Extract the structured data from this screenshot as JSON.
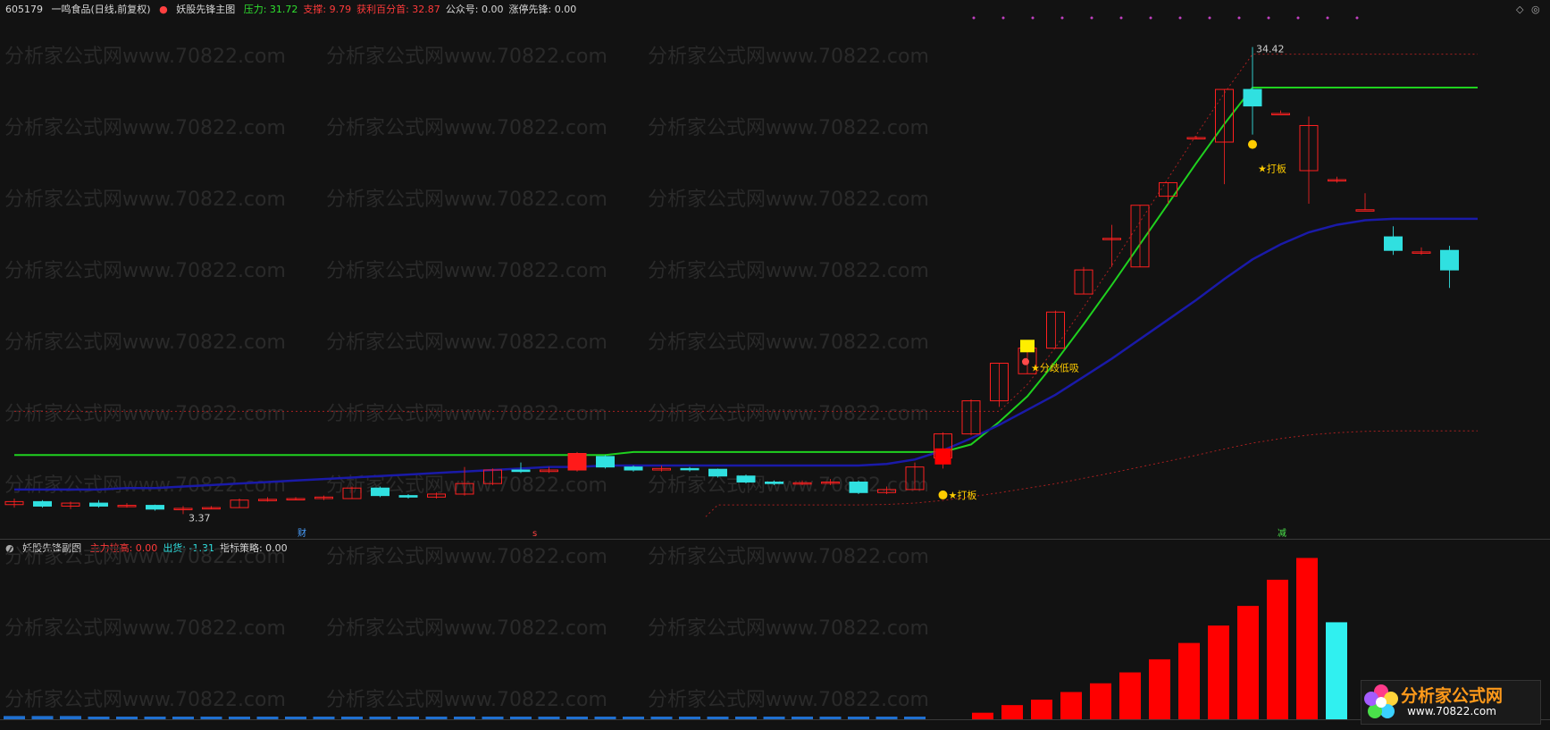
{
  "main_header": {
    "code": "605179",
    "name": "一鸣食品(日线,前复权)",
    "indicator": "妖股先锋主图",
    "items": [
      {
        "label": "压力:",
        "value": "31.72",
        "color": "#2fe12f"
      },
      {
        "label": "支撑:",
        "value": "9.79",
        "color": "#ff3a3a"
      },
      {
        "label": "获利百分首:",
        "value": "32.87",
        "color": "#ff3a3a"
      },
      {
        "label": "公众号:",
        "value": "0.00",
        "color": "#d8d8d8"
      },
      {
        "label": "涨停先锋:",
        "value": "0.00",
        "color": "#d8d8d8"
      }
    ]
  },
  "sub_header": {
    "indicator": "妖股先锋副图",
    "items": [
      {
        "label": "主力拉高:",
        "value": "0.00",
        "color": "#ff3a3a"
      },
      {
        "label": "出货:",
        "value": "-1.31",
        "color": "#30e0e0"
      },
      {
        "label": "指标策略:",
        "value": "0.00",
        "color": "#d8d8d8"
      }
    ]
  },
  "watermark": "分析家公式网www.70822.com",
  "annotations": {
    "high_price": "34.42",
    "low_price": "3.37",
    "signal_daban": "★打板",
    "signal_fenshi": "★分歧低吸",
    "marker_cai": "财",
    "marker_jian": "减",
    "marker_s": "s"
  },
  "logo": {
    "title": "分析家公式网",
    "url": "www.70822.com"
  },
  "chart_data": {
    "type": "candlestick",
    "price_range": [
      3.37,
      34.42
    ],
    "candles": [
      {
        "o": 4.0,
        "c": 4.2,
        "h": 4.4,
        "l": 3.8
      },
      {
        "o": 4.2,
        "c": 3.9,
        "h": 4.3,
        "l": 3.8
      },
      {
        "o": 3.9,
        "c": 4.1,
        "h": 4.2,
        "l": 3.7
      },
      {
        "o": 4.1,
        "c": 3.9,
        "h": 4.3,
        "l": 3.8
      },
      {
        "o": 3.9,
        "c": 3.95,
        "h": 4.1,
        "l": 3.8
      },
      {
        "o": 3.95,
        "c": 3.7,
        "h": 4.0,
        "l": 3.6
      },
      {
        "o": 3.7,
        "c": 3.75,
        "h": 3.9,
        "l": 3.37
      },
      {
        "o": 3.75,
        "c": 3.8,
        "h": 3.9,
        "l": 3.7
      },
      {
        "o": 3.8,
        "c": 4.3,
        "h": 4.4,
        "l": 3.8
      },
      {
        "o": 4.3,
        "c": 4.35,
        "h": 4.5,
        "l": 4.2
      },
      {
        "o": 4.35,
        "c": 4.4,
        "h": 4.5,
        "l": 4.3
      },
      {
        "o": 4.4,
        "c": 4.5,
        "h": 4.6,
        "l": 4.3
      },
      {
        "o": 4.4,
        "c": 5.1,
        "h": 5.2,
        "l": 4.4
      },
      {
        "o": 5.1,
        "c": 4.6,
        "h": 5.2,
        "l": 4.5
      },
      {
        "o": 4.6,
        "c": 4.5,
        "h": 4.7,
        "l": 4.4
      },
      {
        "o": 4.5,
        "c": 4.7,
        "h": 4.8,
        "l": 4.4
      },
      {
        "o": 4.7,
        "c": 5.4,
        "h": 6.5,
        "l": 4.6
      },
      {
        "o": 5.4,
        "c": 6.3,
        "h": 6.4,
        "l": 5.3
      },
      {
        "o": 6.3,
        "c": 6.2,
        "h": 6.8,
        "l": 6.1
      },
      {
        "o": 6.2,
        "c": 6.3,
        "h": 6.5,
        "l": 6.1
      },
      {
        "o": 6.3,
        "c": 7.4,
        "h": 7.5,
        "l": 6.2
      },
      {
        "o": 7.2,
        "c": 6.5,
        "h": 7.3,
        "l": 6.4
      },
      {
        "o": 6.5,
        "c": 6.3,
        "h": 6.6,
        "l": 6.2
      },
      {
        "o": 6.3,
        "c": 6.4,
        "h": 6.6,
        "l": 6.2
      },
      {
        "o": 6.4,
        "c": 6.35,
        "h": 6.5,
        "l": 6.2
      },
      {
        "o": 6.35,
        "c": 5.9,
        "h": 6.4,
        "l": 5.8
      },
      {
        "o": 5.9,
        "c": 5.5,
        "h": 6.0,
        "l": 5.4
      },
      {
        "o": 5.5,
        "c": 5.4,
        "h": 5.6,
        "l": 5.3
      },
      {
        "o": 5.4,
        "c": 5.45,
        "h": 5.6,
        "l": 5.3
      },
      {
        "o": 5.45,
        "c": 5.5,
        "h": 5.7,
        "l": 5.3
      },
      {
        "o": 5.5,
        "c": 4.8,
        "h": 5.6,
        "l": 4.7
      },
      {
        "o": 4.8,
        "c": 5.0,
        "h": 5.2,
        "l": 4.7
      },
      {
        "o": 5.0,
        "c": 6.5,
        "h": 6.8,
        "l": 5.0
      },
      {
        "o": 7.1,
        "c": 8.7,
        "h": 8.8,
        "l": 6.4
      },
      {
        "o": 8.7,
        "c": 10.9,
        "h": 11.0,
        "l": 8.6
      },
      {
        "o": 10.9,
        "c": 13.4,
        "h": 13.4,
        "l": 10.5
      },
      {
        "o": 12.7,
        "c": 14.4,
        "h": 14.4,
        "l": 12.7
      },
      {
        "o": 14.4,
        "c": 16.8,
        "h": 16.9,
        "l": 14.4
      },
      {
        "o": 18.0,
        "c": 19.6,
        "h": 19.8,
        "l": 18.0
      },
      {
        "o": 21.7,
        "c": 21.7,
        "h": 22.6,
        "l": 19.8
      },
      {
        "o": 19.8,
        "c": 23.9,
        "h": 23.9,
        "l": 19.8
      },
      {
        "o": 24.5,
        "c": 25.4,
        "h": 25.4,
        "l": 24.0
      },
      {
        "o": 28.4,
        "c": 28.4,
        "h": 28.5,
        "l": 28.3
      },
      {
        "o": 28.1,
        "c": 31.6,
        "h": 31.6,
        "l": 25.3
      },
      {
        "o": 31.6,
        "c": 30.5,
        "h": 34.42,
        "l": 28.6
      },
      {
        "o": 30.0,
        "c": 30.0,
        "h": 30.2,
        "l": 30.0
      },
      {
        "o": 26.2,
        "c": 29.2,
        "h": 29.8,
        "l": 24.0
      },
      {
        "o": 25.6,
        "c": 25.6,
        "h": 25.8,
        "l": 25.4
      },
      {
        "o": 23.6,
        "c": 23.6,
        "h": 24.7,
        "l": 23.6
      },
      {
        "o": 21.8,
        "c": 20.9,
        "h": 22.5,
        "l": 20.6
      },
      {
        "o": 20.8,
        "c": 20.8,
        "h": 21.1,
        "l": 20.6
      },
      {
        "o": 20.9,
        "c": 19.6,
        "h": 21.2,
        "l": 18.4
      }
    ],
    "resistance_line": [
      7.3,
      7.3,
      7.3,
      7.3,
      7.3,
      7.3,
      7.3,
      7.3,
      7.3,
      7.3,
      7.3,
      7.3,
      7.3,
      7.3,
      7.3,
      7.3,
      7.3,
      7.3,
      7.3,
      7.3,
      7.3,
      7.3,
      7.5,
      7.5,
      7.5,
      7.5,
      7.5,
      7.5,
      7.5,
      7.5,
      7.5,
      7.5,
      7.5,
      7.5,
      8.0,
      9.5,
      11.2,
      13.5,
      16.0,
      18.6,
      21.3,
      24.0,
      26.7,
      29.3,
      31.72,
      31.72,
      31.72,
      31.72,
      31.72,
      31.72,
      31.72,
      31.72,
      31.72
    ],
    "support_line": [
      5.0,
      5.0,
      5.0,
      5.0,
      5.1,
      5.1,
      5.2,
      5.3,
      5.4,
      5.5,
      5.6,
      5.7,
      5.8,
      5.9,
      6.0,
      6.1,
      6.2,
      6.3,
      6.4,
      6.5,
      6.5,
      6.6,
      6.6,
      6.6,
      6.6,
      6.6,
      6.6,
      6.6,
      6.6,
      6.6,
      6.6,
      6.7,
      7.0,
      7.6,
      8.4,
      9.3,
      10.3,
      11.3,
      12.5,
      13.7,
      15.0,
      16.3,
      17.6,
      19.0,
      20.3,
      21.3,
      22.1,
      22.6,
      22.9,
      23.0,
      23.0,
      23.0,
      23.0
    ],
    "volume_bars": [
      {
        "v": 0.3,
        "type": "blue"
      },
      {
        "v": 0.3,
        "type": "blue"
      },
      {
        "v": 0.3,
        "type": "blue"
      },
      {
        "v": 0.2,
        "type": "blue"
      },
      {
        "v": 0.2,
        "type": "blue"
      },
      {
        "v": 0.2,
        "type": "blue"
      },
      {
        "v": 0.2,
        "type": "blue"
      },
      {
        "v": 0.2,
        "type": "blue"
      },
      {
        "v": 0.2,
        "type": "blue"
      },
      {
        "v": 0.2,
        "type": "blue"
      },
      {
        "v": 0.2,
        "type": "blue"
      },
      {
        "v": 0.2,
        "type": "blue"
      },
      {
        "v": 0.2,
        "type": "blue"
      },
      {
        "v": 0.2,
        "type": "blue"
      },
      {
        "v": 0.2,
        "type": "blue"
      },
      {
        "v": 0.2,
        "type": "blue"
      },
      {
        "v": 0.2,
        "type": "blue"
      },
      {
        "v": 0.2,
        "type": "blue"
      },
      {
        "v": 0.2,
        "type": "blue"
      },
      {
        "v": 0.2,
        "type": "blue"
      },
      {
        "v": 0.2,
        "type": "blue"
      },
      {
        "v": 0.2,
        "type": "blue"
      },
      {
        "v": 0.2,
        "type": "blue"
      },
      {
        "v": 0.2,
        "type": "blue"
      },
      {
        "v": 0.2,
        "type": "blue"
      },
      {
        "v": 0.2,
        "type": "blue"
      },
      {
        "v": 0.2,
        "type": "blue"
      },
      {
        "v": 0.2,
        "type": "blue"
      },
      {
        "v": 0.2,
        "type": "blue"
      },
      {
        "v": 0.2,
        "type": "blue"
      },
      {
        "v": 0.2,
        "type": "blue"
      },
      {
        "v": 0.2,
        "type": "blue"
      },
      {
        "v": 0.2,
        "type": "blue"
      },
      {
        "v": 0.6,
        "type": "red"
      },
      {
        "v": 1.3,
        "type": "red"
      },
      {
        "v": 1.8,
        "type": "red"
      },
      {
        "v": 2.5,
        "type": "red"
      },
      {
        "v": 3.3,
        "type": "red"
      },
      {
        "v": 4.3,
        "type": "red"
      },
      {
        "v": 5.5,
        "type": "red"
      },
      {
        "v": 7.0,
        "type": "red"
      },
      {
        "v": 8.6,
        "type": "red"
      },
      {
        "v": 10.4,
        "type": "red"
      },
      {
        "v": 12.8,
        "type": "red"
      },
      {
        "v": 14.8,
        "type": "red"
      },
      {
        "v": 8.9,
        "type": "cyan"
      }
    ]
  }
}
